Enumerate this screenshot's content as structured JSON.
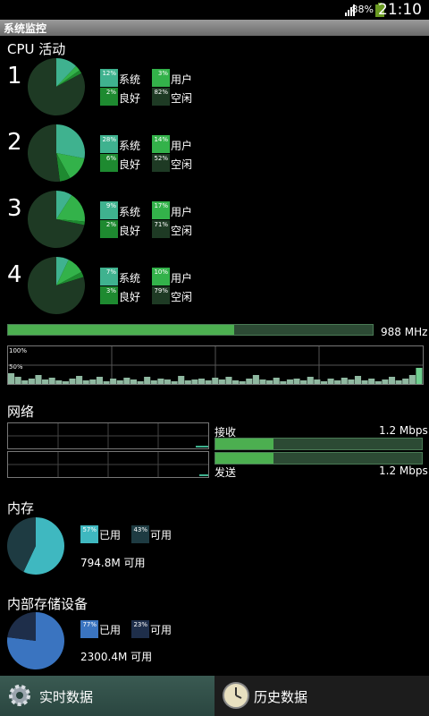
{
  "status_bar": {
    "battery_pct": "88%",
    "time": "21:10"
  },
  "title": "系统监控",
  "cpu": {
    "title": "CPU 活动",
    "labels": {
      "system": "系统",
      "user": "用户",
      "nice": "良好",
      "idle": "空闲"
    },
    "colors": {
      "system": "#3fb28f",
      "user": "#33b24a",
      "nice": "#1e8a30",
      "idle": "#1e3a24"
    },
    "cores": [
      {
        "number": "1",
        "system": "12%",
        "user": "3%",
        "nice": "2%",
        "idle": "82%"
      },
      {
        "number": "2",
        "system": "28%",
        "user": "14%",
        "nice": "6%",
        "idle": "52%"
      },
      {
        "number": "3",
        "system": "9%",
        "user": "17%",
        "nice": "2%",
        "idle": "71%"
      },
      {
        "number": "4",
        "system": "7%",
        "user": "10%",
        "nice": "3%",
        "idle": "79%"
      }
    ],
    "frequency": "988 MHz",
    "frequency_fill": 0.62,
    "graph_max_label": "100%",
    "graph_mid_label": "50%"
  },
  "network": {
    "title": "网络",
    "receive_label": "接收",
    "receive_value": "1.2 Mbps",
    "receive_fill": 0.28,
    "send_label": "发送",
    "send_value": "1.2 Mbps",
    "send_fill": 0.28
  },
  "memory": {
    "title": "内存",
    "used_pct": "57%",
    "used_label": "已用",
    "free_pct": "43%",
    "free_label": "可用",
    "available_text": "794.8M 可用",
    "used_color": "#3fb8c0",
    "free_color": "#1e3b42"
  },
  "storage": {
    "title": "内部存储设备",
    "used_pct": "77%",
    "used_label": "已用",
    "free_pct": "23%",
    "free_label": "可用",
    "available_text": "2300.4M 可用",
    "used_color": "#3a74c0",
    "free_color": "#1e2e4a"
  },
  "nav": {
    "realtime": "实时数据",
    "history": "历史数据"
  }
}
